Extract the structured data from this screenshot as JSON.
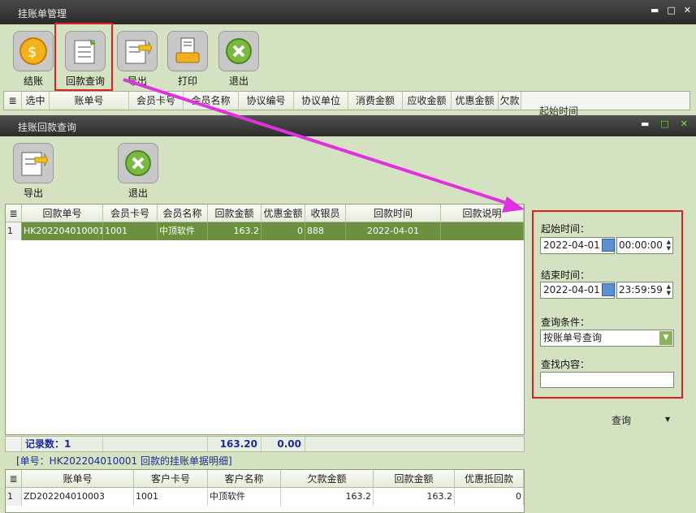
{
  "outer": {
    "title": "挂账单管理",
    "toolbar": [
      {
        "label": "结账",
        "icon": "settle-icon"
      },
      {
        "label": "回款查询",
        "icon": "payment-query-icon"
      },
      {
        "label": "导出",
        "icon": "export-icon"
      },
      {
        "label": "打印",
        "icon": "print-icon"
      },
      {
        "label": "退出",
        "icon": "exit-icon"
      }
    ],
    "columns": [
      "选中",
      "账单号",
      "会员卡号",
      "会员名称",
      "协议编号",
      "协议单位",
      "消费金额",
      "应收金额",
      "优惠金额",
      "欠款"
    ],
    "side_hint": "起始时间"
  },
  "inner": {
    "title": "挂账回款查询",
    "toolbar": [
      {
        "label": "导出",
        "icon": "export-icon"
      },
      {
        "label": "退出",
        "icon": "exit-icon"
      }
    ],
    "columns": [
      "回款单号",
      "会员卡号",
      "会员名称",
      "回款金额",
      "优惠金额",
      "收银员",
      "回款时间",
      "回款说明"
    ],
    "rows": [
      {
        "index": "1",
        "no": "HK202204010001",
        "card": "1001",
        "name": "中顶软件",
        "amount": "163.2",
        "discount": "0",
        "cashier": "888",
        "time": "2022-04-01",
        "remark": ""
      }
    ],
    "summary": {
      "records": "记录数：1",
      "amount_total": "163.20",
      "discount_total": "0.00"
    },
    "detail_caption": "[单号：HK202204010001 回款的挂账单据明细]",
    "detail_columns": [
      "账单号",
      "客户卡号",
      "客户名称",
      "欠款金额",
      "回款金额",
      "优惠抵回款"
    ],
    "detail_rows": [
      {
        "index": "1",
        "bill": "ZD202204010003",
        "card": "1001",
        "name": "中顶软件",
        "debt": "163.2",
        "paid": "163.2",
        "offset": "0"
      }
    ]
  },
  "filter": {
    "start_label": "起始时间：",
    "start_date": "2022-04-01",
    "start_time": "00:00:00",
    "end_label": "结束时间：",
    "end_date": "2022-04-01",
    "end_time": "23:59:59",
    "condition_label": "查询条件：",
    "condition_value": "按账单号查询",
    "content_label": "查找内容：",
    "content_value": "",
    "query_button": "查询"
  },
  "colors": {
    "accent_red": "#e02020",
    "arrow_magenta": "#e030e0",
    "selected_row": "#6b9040",
    "summary_text": "#1b2b9a"
  }
}
